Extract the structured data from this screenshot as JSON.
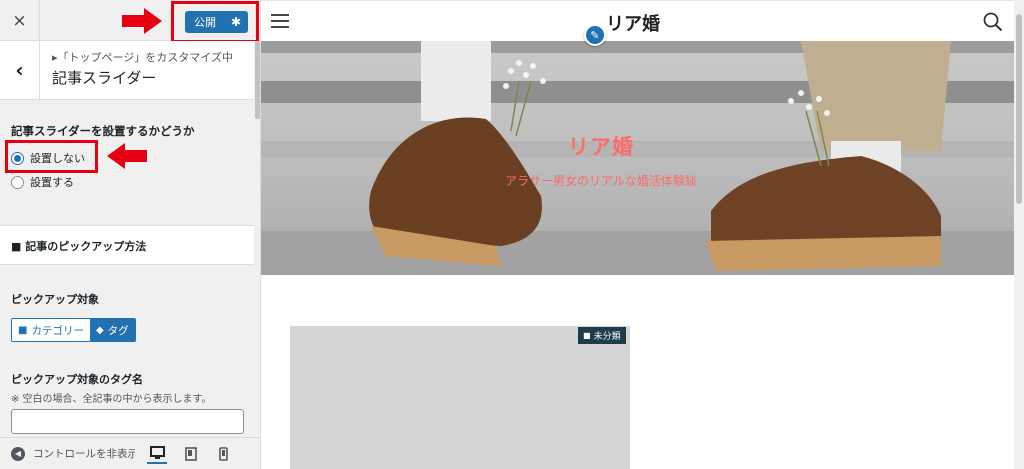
{
  "panel": {
    "close_label": "×",
    "publish_label": "公開",
    "breadcrumb": "▸「トップページ」をカスタマイズ中",
    "section_title": "記事スライダー",
    "back_label": "‹",
    "slider_control": {
      "label": "記事スライダーを設置するかどうか",
      "options": [
        {
          "label": "設置しない",
          "checked": true
        },
        {
          "label": "設置する",
          "checked": false
        }
      ]
    },
    "pickup_method_title": "■ 記事のピックアップ方法",
    "pickup_target": {
      "label": "ピックアップ対象",
      "options": [
        {
          "label": "カテゴリー",
          "icon": "folder-icon",
          "selected": false
        },
        {
          "label": "タグ",
          "icon": "tag-icon",
          "selected": true
        }
      ]
    },
    "tag_name": {
      "label": "ピックアップ対象のタグ名",
      "description": "※ 空白の場合、全記事の中から表示します。",
      "value": ""
    },
    "footer": {
      "collapse_label": "コントロールを非表示",
      "devices": [
        "desktop",
        "tablet",
        "mobile"
      ],
      "active_device": "desktop"
    }
  },
  "preview": {
    "site_name": "リア婚",
    "hero": {
      "title": "リア婚",
      "subtitle": "アラサー男女のリアルな婚活体験談"
    },
    "card_badge": "未分類"
  },
  "colors": {
    "accent": "#2271b1",
    "highlight": "#e60012",
    "hero_text": "#ff6a6a",
    "badge_bg": "#1d3c4c"
  }
}
